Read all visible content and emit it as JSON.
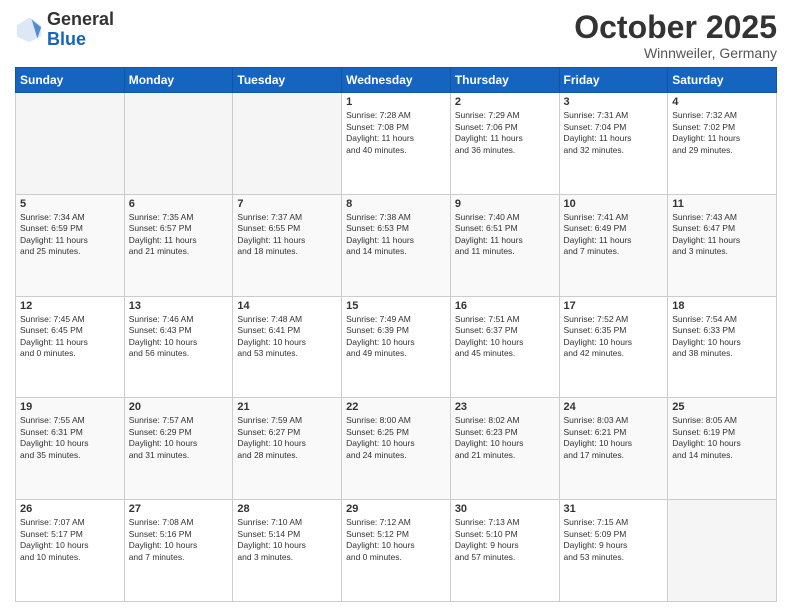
{
  "header": {
    "logo": {
      "general": "General",
      "blue": "Blue"
    },
    "month": "October 2025",
    "location": "Winnweiler, Germany"
  },
  "weekdays": [
    "Sunday",
    "Monday",
    "Tuesday",
    "Wednesday",
    "Thursday",
    "Friday",
    "Saturday"
  ],
  "weeks": [
    [
      {
        "day": "",
        "info": ""
      },
      {
        "day": "",
        "info": ""
      },
      {
        "day": "",
        "info": ""
      },
      {
        "day": "1",
        "info": "Sunrise: 7:28 AM\nSunset: 7:08 PM\nDaylight: 11 hours\nand 40 minutes."
      },
      {
        "day": "2",
        "info": "Sunrise: 7:29 AM\nSunset: 7:06 PM\nDaylight: 11 hours\nand 36 minutes."
      },
      {
        "day": "3",
        "info": "Sunrise: 7:31 AM\nSunset: 7:04 PM\nDaylight: 11 hours\nand 32 minutes."
      },
      {
        "day": "4",
        "info": "Sunrise: 7:32 AM\nSunset: 7:02 PM\nDaylight: 11 hours\nand 29 minutes."
      }
    ],
    [
      {
        "day": "5",
        "info": "Sunrise: 7:34 AM\nSunset: 6:59 PM\nDaylight: 11 hours\nand 25 minutes."
      },
      {
        "day": "6",
        "info": "Sunrise: 7:35 AM\nSunset: 6:57 PM\nDaylight: 11 hours\nand 21 minutes."
      },
      {
        "day": "7",
        "info": "Sunrise: 7:37 AM\nSunset: 6:55 PM\nDaylight: 11 hours\nand 18 minutes."
      },
      {
        "day": "8",
        "info": "Sunrise: 7:38 AM\nSunset: 6:53 PM\nDaylight: 11 hours\nand 14 minutes."
      },
      {
        "day": "9",
        "info": "Sunrise: 7:40 AM\nSunset: 6:51 PM\nDaylight: 11 hours\nand 11 minutes."
      },
      {
        "day": "10",
        "info": "Sunrise: 7:41 AM\nSunset: 6:49 PM\nDaylight: 11 hours\nand 7 minutes."
      },
      {
        "day": "11",
        "info": "Sunrise: 7:43 AM\nSunset: 6:47 PM\nDaylight: 11 hours\nand 3 minutes."
      }
    ],
    [
      {
        "day": "12",
        "info": "Sunrise: 7:45 AM\nSunset: 6:45 PM\nDaylight: 11 hours\nand 0 minutes."
      },
      {
        "day": "13",
        "info": "Sunrise: 7:46 AM\nSunset: 6:43 PM\nDaylight: 10 hours\nand 56 minutes."
      },
      {
        "day": "14",
        "info": "Sunrise: 7:48 AM\nSunset: 6:41 PM\nDaylight: 10 hours\nand 53 minutes."
      },
      {
        "day": "15",
        "info": "Sunrise: 7:49 AM\nSunset: 6:39 PM\nDaylight: 10 hours\nand 49 minutes."
      },
      {
        "day": "16",
        "info": "Sunrise: 7:51 AM\nSunset: 6:37 PM\nDaylight: 10 hours\nand 45 minutes."
      },
      {
        "day": "17",
        "info": "Sunrise: 7:52 AM\nSunset: 6:35 PM\nDaylight: 10 hours\nand 42 minutes."
      },
      {
        "day": "18",
        "info": "Sunrise: 7:54 AM\nSunset: 6:33 PM\nDaylight: 10 hours\nand 38 minutes."
      }
    ],
    [
      {
        "day": "19",
        "info": "Sunrise: 7:55 AM\nSunset: 6:31 PM\nDaylight: 10 hours\nand 35 minutes."
      },
      {
        "day": "20",
        "info": "Sunrise: 7:57 AM\nSunset: 6:29 PM\nDaylight: 10 hours\nand 31 minutes."
      },
      {
        "day": "21",
        "info": "Sunrise: 7:59 AM\nSunset: 6:27 PM\nDaylight: 10 hours\nand 28 minutes."
      },
      {
        "day": "22",
        "info": "Sunrise: 8:00 AM\nSunset: 6:25 PM\nDaylight: 10 hours\nand 24 minutes."
      },
      {
        "day": "23",
        "info": "Sunrise: 8:02 AM\nSunset: 6:23 PM\nDaylight: 10 hours\nand 21 minutes."
      },
      {
        "day": "24",
        "info": "Sunrise: 8:03 AM\nSunset: 6:21 PM\nDaylight: 10 hours\nand 17 minutes."
      },
      {
        "day": "25",
        "info": "Sunrise: 8:05 AM\nSunset: 6:19 PM\nDaylight: 10 hours\nand 14 minutes."
      }
    ],
    [
      {
        "day": "26",
        "info": "Sunrise: 7:07 AM\nSunset: 5:17 PM\nDaylight: 10 hours\nand 10 minutes."
      },
      {
        "day": "27",
        "info": "Sunrise: 7:08 AM\nSunset: 5:16 PM\nDaylight: 10 hours\nand 7 minutes."
      },
      {
        "day": "28",
        "info": "Sunrise: 7:10 AM\nSunset: 5:14 PM\nDaylight: 10 hours\nand 3 minutes."
      },
      {
        "day": "29",
        "info": "Sunrise: 7:12 AM\nSunset: 5:12 PM\nDaylight: 10 hours\nand 0 minutes."
      },
      {
        "day": "30",
        "info": "Sunrise: 7:13 AM\nSunset: 5:10 PM\nDaylight: 9 hours\nand 57 minutes."
      },
      {
        "day": "31",
        "info": "Sunrise: 7:15 AM\nSunset: 5:09 PM\nDaylight: 9 hours\nand 53 minutes."
      },
      {
        "day": "",
        "info": ""
      }
    ]
  ]
}
